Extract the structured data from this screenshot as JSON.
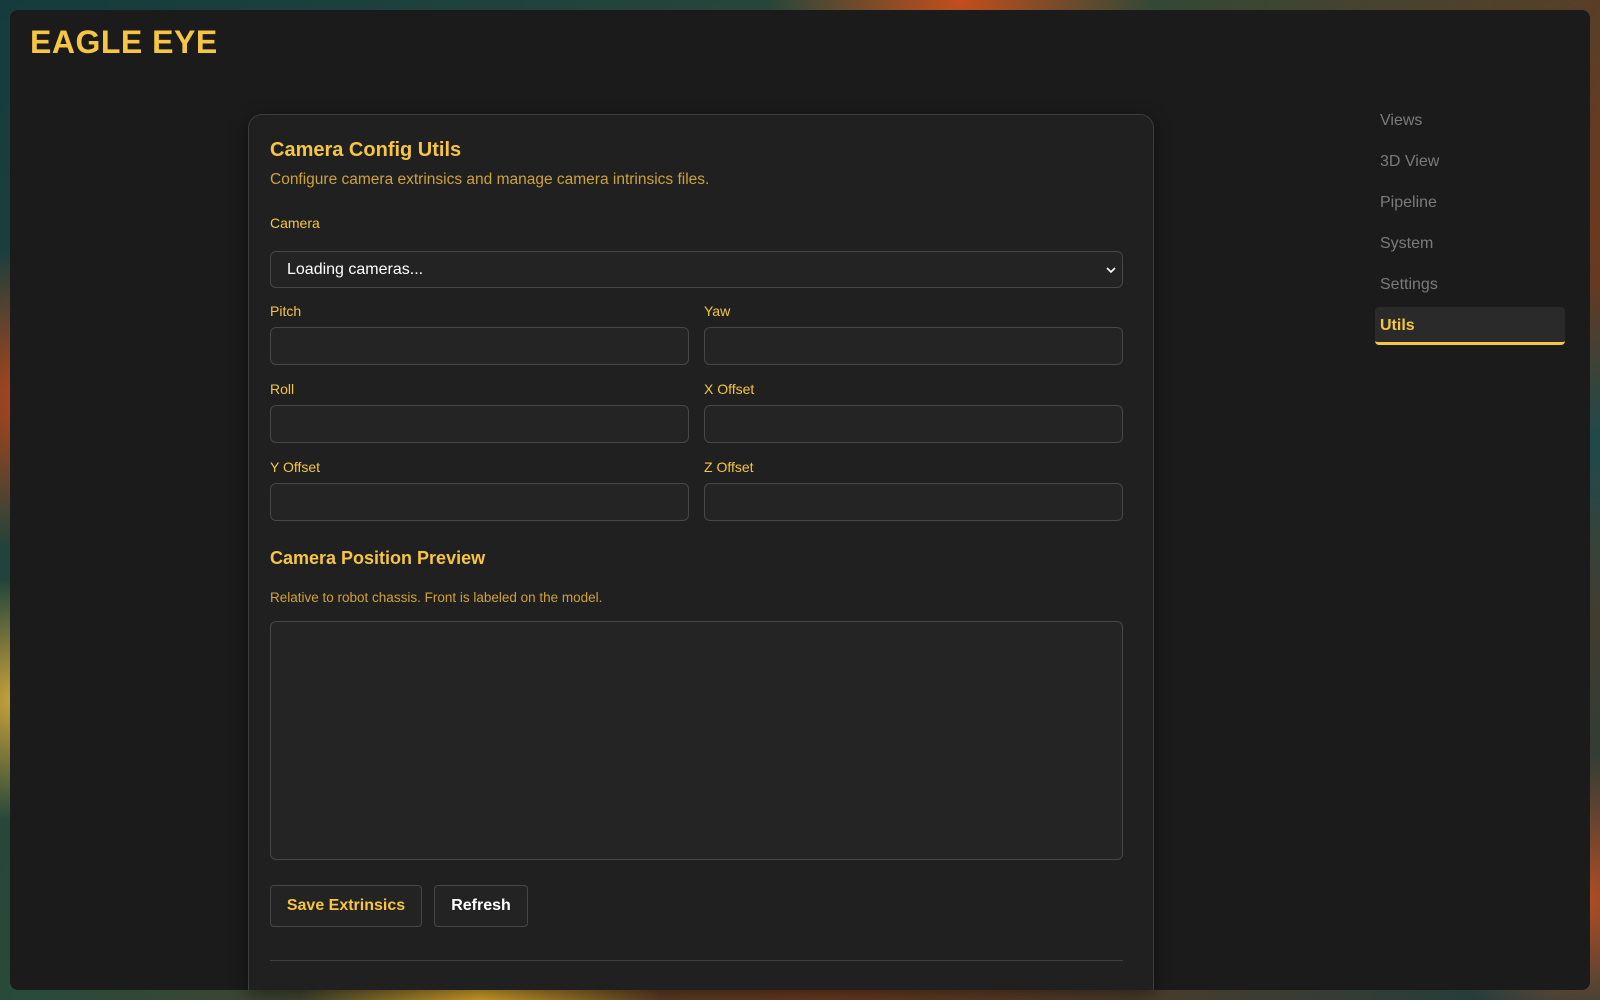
{
  "brand": {
    "title": "EAGLE EYE"
  },
  "nav": {
    "items": [
      {
        "label": "Views",
        "active": false
      },
      {
        "label": "3D View",
        "active": false
      },
      {
        "label": "Pipeline",
        "active": false
      },
      {
        "label": "System",
        "active": false
      },
      {
        "label": "Settings",
        "active": false
      },
      {
        "label": "Utils",
        "active": true
      }
    ]
  },
  "panel": {
    "title": "Camera Config Utils",
    "subtitle": "Configure camera extrinsics and manage camera intrinsics files.",
    "camera": {
      "label": "Camera",
      "selected": "Loading cameras..."
    },
    "fields": {
      "pitch": {
        "label": "Pitch",
        "value": ""
      },
      "yaw": {
        "label": "Yaw",
        "value": ""
      },
      "roll": {
        "label": "Roll",
        "value": ""
      },
      "x_offset": {
        "label": "X Offset",
        "value": ""
      },
      "y_offset": {
        "label": "Y Offset",
        "value": ""
      },
      "z_offset": {
        "label": "Z Offset",
        "value": ""
      }
    },
    "preview": {
      "title": "Camera Position Preview",
      "description": "Relative to robot chassis. Front is labeled on the model."
    },
    "buttons": {
      "save": "Save Extrinsics",
      "refresh": "Refresh"
    }
  },
  "colors": {
    "accent": "#f6c544",
    "muted_accent": "#cda23c",
    "background": "#1b1b1b",
    "panel": "#202020",
    "nav_inactive": "#7b7b7b"
  }
}
